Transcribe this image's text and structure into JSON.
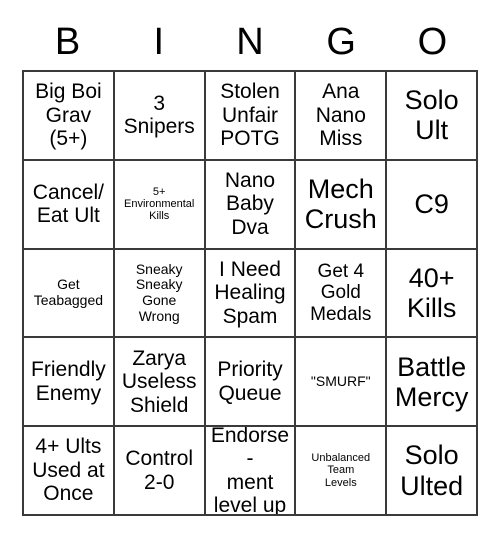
{
  "card": {
    "title_letters": [
      "B",
      "I",
      "N",
      "G",
      "O"
    ],
    "columns": 5,
    "rows": 5,
    "border_color": "#3a3a3a",
    "background_color": "#ffffff",
    "text_color": "#000000",
    "cells": [
      {
        "text": "Big Boi\nGrav\n(5+)",
        "size": "size-lg"
      },
      {
        "text": "3\nSnipers",
        "size": "size-lg"
      },
      {
        "text": "Stolen\nUnfair\nPOTG",
        "size": "size-lg"
      },
      {
        "text": "Ana\nNano\nMiss",
        "size": "size-lg"
      },
      {
        "text": "Solo\nUlt",
        "size": "size-xl"
      },
      {
        "text": "Cancel/\nEat Ult",
        "size": "size-lg"
      },
      {
        "text": "5+\nEnvironmental\nKills",
        "size": "size-xs"
      },
      {
        "text": "Nano\nBaby\nDva",
        "size": "size-lg"
      },
      {
        "text": "Mech\nCrush",
        "size": "size-xl"
      },
      {
        "text": "C9",
        "size": "size-xl"
      },
      {
        "text": "Get\nTeabagged",
        "size": "size-sm"
      },
      {
        "text": "Sneaky\nSneaky\nGone\nWrong",
        "size": "size-sm"
      },
      {
        "text": "I Need\nHealing\nSpam",
        "size": "size-lg"
      },
      {
        "text": "Get 4\nGold\nMedals",
        "size": "size-md"
      },
      {
        "text": "40+\nKills",
        "size": "size-xl"
      },
      {
        "text": "Friendly\nEnemy",
        "size": "size-lg"
      },
      {
        "text": "Zarya\nUseless\nShield",
        "size": "size-lg"
      },
      {
        "text": "Priority\nQueue",
        "size": "size-lg"
      },
      {
        "text": "\"SMURF\"",
        "size": "size-sm"
      },
      {
        "text": "Battle\nMercy",
        "size": "size-xl"
      },
      {
        "text": "4+ Ults\nUsed at\nOnce",
        "size": "size-lg"
      },
      {
        "text": "Control\n2-0",
        "size": "size-lg"
      },
      {
        "text": "Endorse-\nment\nlevel up",
        "size": "size-lg"
      },
      {
        "text": "Unbalanced\nTeam\nLevels",
        "size": "size-xs"
      },
      {
        "text": "Solo\nUlted",
        "size": "size-xl"
      }
    ]
  }
}
